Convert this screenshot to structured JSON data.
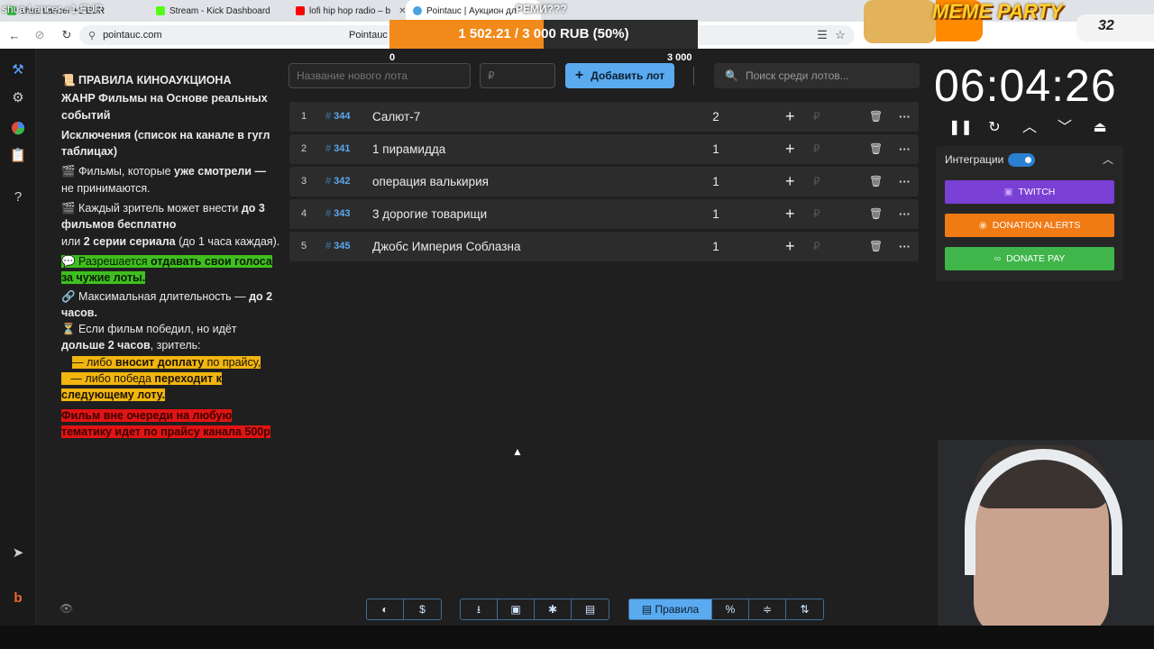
{
  "browser": {
    "tabs": [
      {
        "label": "shua Lancer +1 EUR",
        "color": "#3ac24a"
      },
      {
        "label": "Stream - Kick Dashboard",
        "color": "#53fc18"
      },
      {
        "label": "lofi hip hop radio – b",
        "color": "#ff0000"
      },
      {
        "label": "Pointauc | Аукцион дл",
        "color": "#46a3e0"
      }
    ],
    "url": "pointauc.com",
    "page_title": "Pointauc |"
  },
  "overlay": {
    "progress_label": "1 502.21 / 3 000 RUB (50%)",
    "progress_fraction": 0.5,
    "progress_min": "0",
    "progress_max": "3 000",
    "rem_text": "РЕМИ???",
    "meme_title": "MEME PARTY",
    "meme_count": "32"
  },
  "sidebar": {
    "items": [
      "gavel-icon",
      "gear-icon",
      "pie-chart-icon",
      "clipboard-icon",
      "help-icon",
      "telegram-icon",
      "boosty-icon"
    ]
  },
  "rules": {
    "title": "📜 ПРАВИЛА КИНОАУКЦИОНА",
    "genre": "ЖАНР Фильмы на Основе реальных событий",
    "exceptions": "Исключения (список на канале в гугл таблицах)",
    "line1a": "🎬 Фильмы, которые ",
    "line1b": "уже смотрели —",
    "line1c": " не принимаются.",
    "line2a": "🎬 Каждый зритель может внести ",
    "line2b": "до 3 фильмов бесплатно",
    "line2c": "или ",
    "line2d": "2 серии сериала",
    "line2e": " (до 1 часа каждая).",
    "line3a": "💬 Разрешается ",
    "line3b": "отдавать свои голоса за чужие лоты.",
    "line4a": "🔗 Максимальная длительность — ",
    "line4b": "до 2 часов.",
    "line5a": "⏳ Если фильм победил, но идёт ",
    "line5b": "дольше 2 часов",
    "line5c": ", зритель:",
    "line6a": "— либо ",
    "line6b": "вносит доплату",
    "line6c": " по прайсу,",
    "line7a": "— либо победа ",
    "line7b": "переходит к следующему лоту.",
    "line8": "Фильм вне очереди на любую тематику идет по прайсу канала 500р"
  },
  "toolbar": {
    "lot_name_placeholder": "Название нового лота",
    "amount_placeholder": "₽",
    "add_label": "Добавить лот",
    "search_placeholder": "Поиск среди лотов..."
  },
  "lots": [
    {
      "idx": "1",
      "id": "344",
      "name": "Салют-7",
      "amount": "2"
    },
    {
      "idx": "2",
      "id": "341",
      "name": " 1 пирамидда",
      "amount": "1"
    },
    {
      "idx": "3",
      "id": "342",
      "name": "операция валькирия",
      "amount": "1"
    },
    {
      "idx": "4",
      "id": "343",
      "name": "3 дорогие товарищи",
      "amount": "1"
    },
    {
      "idx": "5",
      "id": "345",
      "name": "Джобс Империя Соблазна",
      "amount": "1"
    }
  ],
  "timer": {
    "value": "06:04:26"
  },
  "integrations": {
    "label": "Интеграции",
    "enabled": true,
    "twitch": "TWITCH",
    "donation_alerts": "DONATION ALERTS",
    "donate_pay": "DONATE PAY",
    "colors": {
      "twitch": "#7a3fd4",
      "donation_alerts": "#f07a14",
      "donate_pay": "#3fb54a"
    }
  },
  "bottom": {
    "rules_label": "Правила"
  },
  "colors": {
    "accent": "#5aaaf0",
    "bg": "#1f1f1f",
    "row": "#2c2c2c"
  }
}
